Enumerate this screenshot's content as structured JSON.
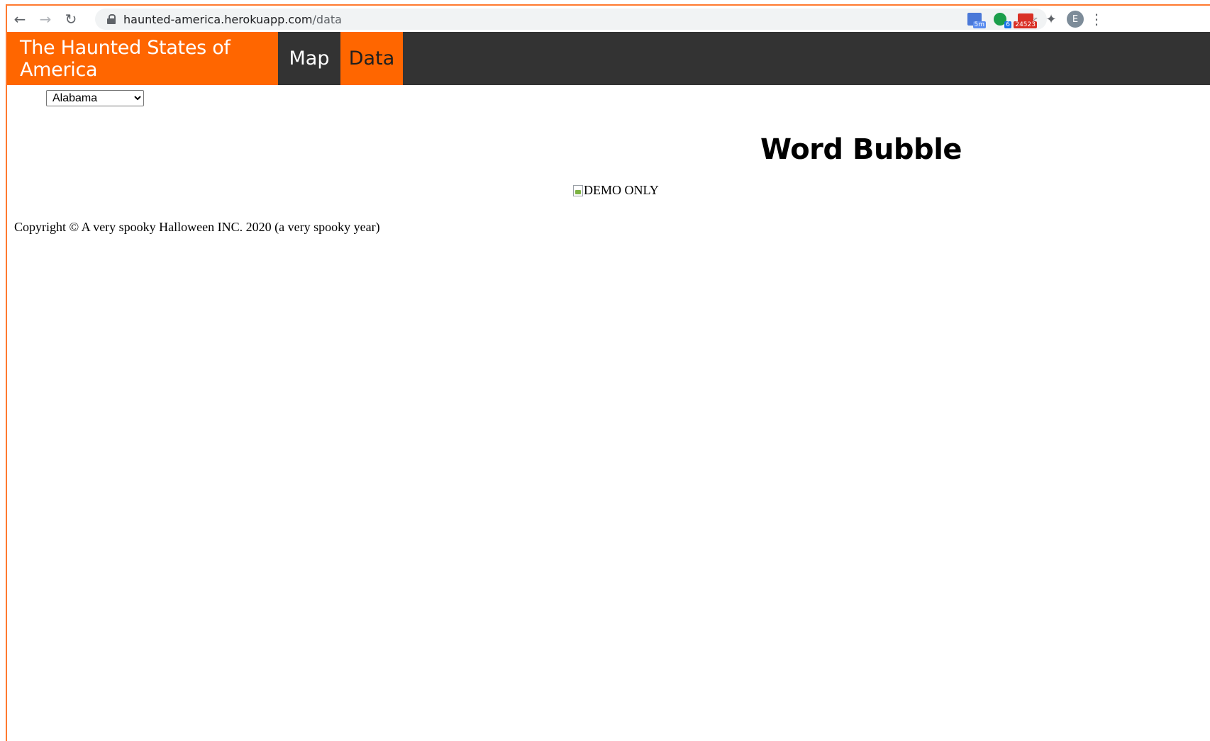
{
  "browser": {
    "url_host": "haunted-america.herokuapp.com",
    "url_path": "/data",
    "icons": {
      "back": "arrow-left-icon",
      "forward": "arrow-right-icon",
      "reload": "reload-icon",
      "lock": "lock-icon",
      "bookmark": "star-icon",
      "extensions": "puzzle-icon",
      "menu": "kebab-icon"
    },
    "extensions": {
      "calendar_badge": "5m",
      "chat_badge": "6",
      "mail_badge": "24523"
    },
    "profile_initial": "E"
  },
  "site": {
    "brand": "The Haunted States of America",
    "nav": [
      {
        "label": "Map",
        "active": false
      },
      {
        "label": "Data",
        "active": true
      }
    ],
    "accent": "#ff6600",
    "nav_bg": "#333333"
  },
  "content": {
    "state_select": {
      "selected": "Alabama",
      "options": [
        "Alabama"
      ]
    },
    "heading": "Word Bubble",
    "image_alt": "DEMO ONLY",
    "footer": "Copyright © A very spooky Halloween INC. 2020 (a very spooky year)"
  }
}
